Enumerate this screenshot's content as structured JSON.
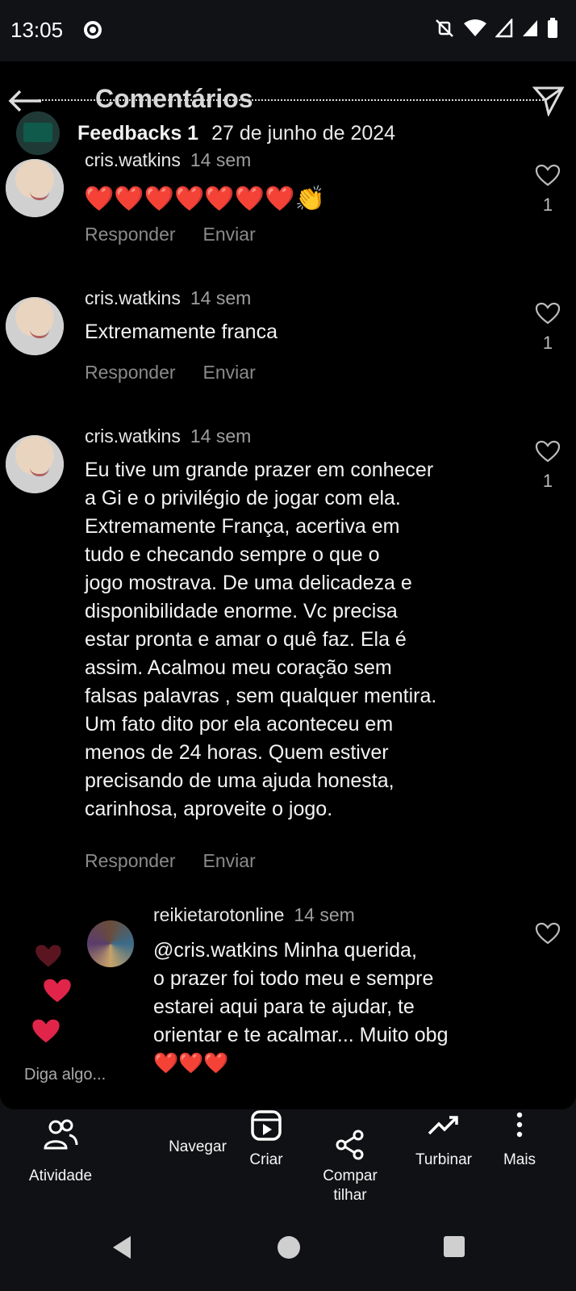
{
  "status_bar": {
    "time": "13:05"
  },
  "header": {
    "title": "Comentários"
  },
  "post": {
    "name": "Feedbacks 1",
    "date": "27 de junho de 2024"
  },
  "comments": [
    {
      "user": "cris.watkins",
      "ago": "14 sem",
      "text": "❤️❤️❤️❤️❤️❤️❤️👏",
      "reply": "Responder",
      "send": "Enviar",
      "likes": "1"
    },
    {
      "user": "cris.watkins",
      "ago": "14 sem",
      "text": "Extremamente franca",
      "reply": "Responder",
      "send": "Enviar",
      "likes": "1"
    },
    {
      "user": "cris.watkins",
      "ago": "14 sem",
      "text": "Eu tive um grande prazer em conhecer\na Gi e o privilégio de jogar com ela.\nExtremamente França, acertiva em\ntudo e checando sempre o que o\njogo mostrava. De uma delicadeza e\ndisponibilidade enorme. Vc precisa\nestar pronta e amar o quê faz. Ela é\nassim. Acalmou meu coração sem\nfalsas palavras , sem qualquer mentira.\nUm fato dito por ela aconteceu em\nmenos de 24 horas. Quem estiver\nprecisando de uma ajuda honesta,\ncarinhosa, aproveite o jogo.",
      "reply": "Responder",
      "send": "Enviar",
      "likes": "1"
    }
  ],
  "reply": {
    "user": "reikietarotonline",
    "ago": "14 sem",
    "text": "@cris.watkins Minha querida,\no prazer foi todo meu e sempre\nestarei aqui para te ajudar, te\norientar e te acalmar... Muito obg\n❤️❤️❤️"
  },
  "input": {
    "placeholder": "Diga algo..."
  },
  "bottom_bar": [
    {
      "label": "Atividade",
      "icon": "people-icon"
    },
    {
      "label": "Navegar",
      "icon": ""
    },
    {
      "label": "Criar",
      "icon": "play-box-icon"
    },
    {
      "label": "Compar\ntilhar",
      "icon": "share-icon"
    },
    {
      "label": "Turbinar",
      "icon": "trending-icon"
    },
    {
      "label": "Mais",
      "icon": "more-vert-icon"
    }
  ],
  "colors": {
    "like_red": "#e1254a",
    "muted": "#8a8a8a",
    "background": "#000000"
  }
}
